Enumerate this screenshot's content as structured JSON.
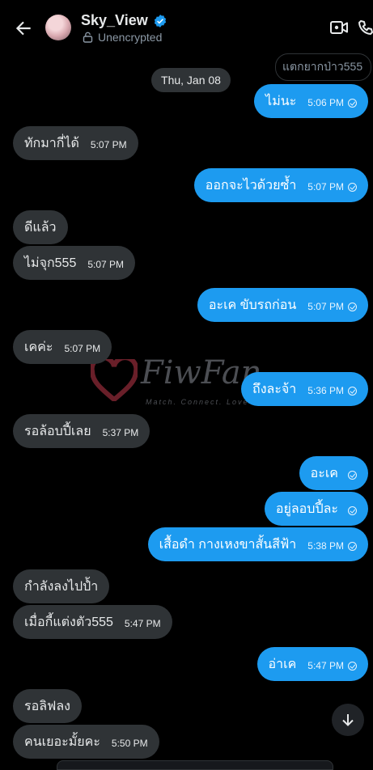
{
  "header": {
    "name": "Sky_View",
    "status": "Unencrypted"
  },
  "date_pill": "Thu, Jan 08",
  "reply_preview": "แตกยากป่าว555",
  "watermark": {
    "brand": "FiwFan",
    "tagline": "Match. Connect. Love"
  },
  "messages": [
    {
      "dir": "out",
      "text": "ไม่นะ",
      "time": "5:06 PM"
    },
    {
      "dir": "in",
      "text": "ทักมากี่ได้",
      "time": "5:07 PM"
    },
    {
      "dir": "out",
      "text": "ออกจะไวด้วยซ้ำ",
      "time": "5:07 PM"
    },
    {
      "dir": "in",
      "text": "ดีแล้ว",
      "time": ""
    },
    {
      "dir": "in",
      "text": "ไม่จุก555",
      "time": "5:07 PM"
    },
    {
      "dir": "out",
      "text": "อะเค ขับรถก่อน",
      "time": "5:07 PM"
    },
    {
      "dir": "in",
      "text": "เคค่ะ",
      "time": "5:07 PM"
    },
    {
      "dir": "out",
      "text": "ถึงละจ้า",
      "time": "5:36 PM"
    },
    {
      "dir": "in",
      "text": "รอล้อบปี้เลย",
      "time": "5:37 PM"
    },
    {
      "dir": "out",
      "text": "อะเค",
      "time": ""
    },
    {
      "dir": "out",
      "text": "อยู่ลอบปี้ละ",
      "time": ""
    },
    {
      "dir": "out",
      "text": "เสื้อดำ กางเหงขาสั้นสีฟ้า",
      "time": "5:38 PM"
    },
    {
      "dir": "in",
      "text": "กำลังลงไปป้ำ",
      "time": ""
    },
    {
      "dir": "in",
      "text": "เมื่อกี้แต่งตัว555",
      "time": "5:47 PM"
    },
    {
      "dir": "out",
      "text": "อ่าเค",
      "time": "5:47 PM"
    },
    {
      "dir": "in",
      "text": "รอลิฟลง",
      "time": ""
    },
    {
      "dir": "in",
      "text": "คนเยอะมั้ยคะ",
      "time": "5:50 PM"
    }
  ],
  "colors": {
    "outgoing": "#1d9bf0",
    "incoming": "#2f3336",
    "background": "#000000",
    "verified": "#1d9bf0"
  }
}
